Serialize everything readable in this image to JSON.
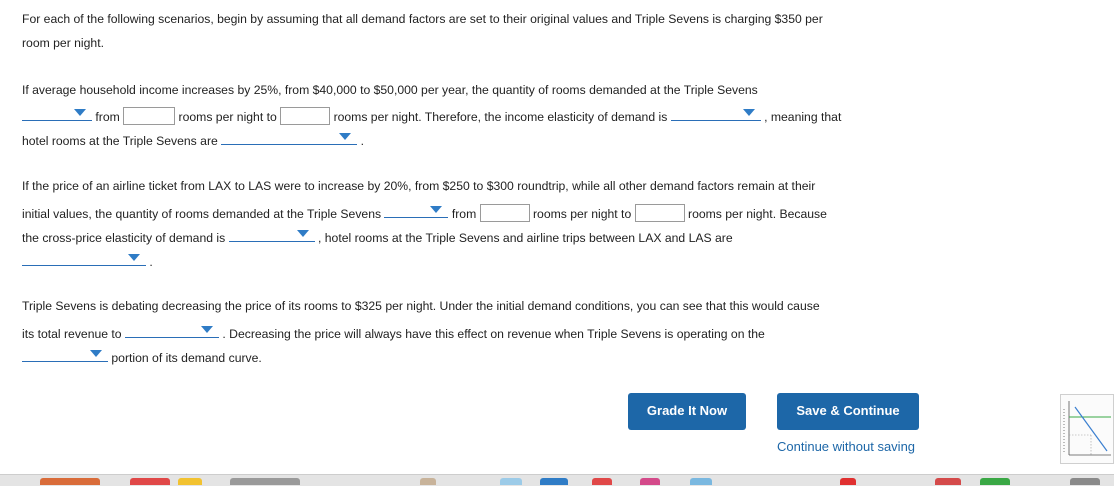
{
  "intro": {
    "line1": "For each of the following scenarios, begin by assuming that all demand factors are set to their original values and Triple Sevens is charging $350 per",
    "line2": "room per night."
  },
  "q1": {
    "line1": "If average household income increases by 25%, from $40,000 to $50,000 per year, the quantity of rooms demanded at the Triple Sevens",
    "from": "from",
    "rooms_to": "rooms per night to",
    "rooms_therefore": "rooms per night. Therefore, the income elasticity of demand is",
    "meaning": ", meaning that",
    "line3": "hotel rooms at the Triple Sevens are",
    "period": "."
  },
  "q2": {
    "line1": "If the price of an airline ticket from LAX to LAS were to increase by 20%, from $250 to $300 roundtrip, while all other demand factors remain at their",
    "line2a": "initial values, the quantity of rooms demanded at the Triple Sevens",
    "from": "from",
    "rooms_to": "rooms per night to",
    "rooms_because": "rooms per night. Because",
    "line3a": "the cross-price elasticity of demand is",
    "line3b": ", hotel rooms at the Triple Sevens and airline trips between LAX and LAS are",
    "period": "."
  },
  "q3": {
    "line1": "Triple Sevens is debating decreasing the price of its rooms to $325 per night. Under the initial demand conditions, you can see that this would cause",
    "line2a": "its total revenue to",
    "line2b": ". Decreasing the price will always have this effect on revenue when Triple Sevens is operating on the",
    "line3": "portion of its demand curve."
  },
  "actions": {
    "grade": "Grade It Now",
    "save": "Save & Continue",
    "continue": "Continue without saving"
  },
  "colors": {
    "button": "#1d67a8",
    "dropdown_arrow": "#2f7cc6",
    "link": "#1d67a8"
  }
}
